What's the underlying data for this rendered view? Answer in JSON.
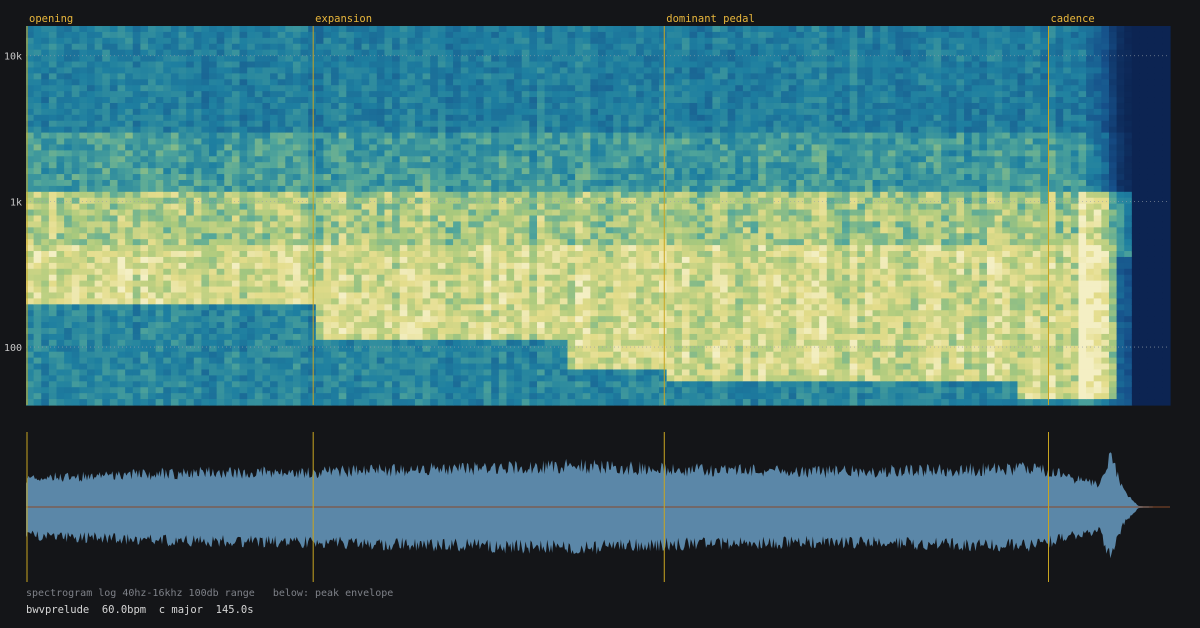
{
  "chart_data": [
    {
      "type": "heatmap",
      "title": "",
      "description_label": "spectrogram log 40hz-16khz 100db range",
      "xlabel": "",
      "ylabel": "",
      "y_scale": "log",
      "ylim": [
        40,
        16000
      ],
      "xlim": [
        0,
        145.0
      ],
      "y_ticks": [
        {
          "value": 10000,
          "label": "10k"
        },
        {
          "value": 1000,
          "label": "1k"
        },
        {
          "value": 100,
          "label": "100"
        }
      ],
      "dynamic_range_db": 100,
      "colormap": [
        "#0b1e4a",
        "#16508a",
        "#1e7fa0",
        "#52a69a",
        "#a9c97d",
        "#e3dc8a",
        "#f4efc4"
      ],
      "section_markers": [
        {
          "label": "opening",
          "time": 0.0
        },
        {
          "label": "expansion",
          "time": 36.4
        },
        {
          "label": "dominant pedal",
          "time": 80.9
        },
        {
          "label": "cadence",
          "time": 129.6
        }
      ],
      "audio_end_time": 139.8,
      "bass_regions": [
        {
          "start": 0.0,
          "end": 36.4,
          "low_band_hz": 200
        },
        {
          "start": 36.4,
          "end": 69.0,
          "low_band_hz": 110
        },
        {
          "start": 69.0,
          "end": 80.9,
          "low_band_hz": 70
        },
        {
          "start": 80.9,
          "end": 125.5,
          "low_band_hz": 60
        },
        {
          "start": 125.5,
          "end": 138.5,
          "low_band_hz": 42
        }
      ]
    },
    {
      "type": "area",
      "title": "",
      "description_label": "below: peak envelope",
      "xlim": [
        0,
        145.0
      ],
      "ylim": [
        -1,
        1
      ],
      "envelope_keypoints": [
        {
          "time": 0.0,
          "amplitude": 0.5
        },
        {
          "time": 20.0,
          "amplitude": 0.6
        },
        {
          "time": 36.4,
          "amplitude": 0.62
        },
        {
          "time": 50.0,
          "amplitude": 0.66
        },
        {
          "time": 70.0,
          "amplitude": 0.72
        },
        {
          "time": 80.9,
          "amplitude": 0.66
        },
        {
          "time": 100.0,
          "amplitude": 0.62
        },
        {
          "time": 120.0,
          "amplitude": 0.66
        },
        {
          "time": 128.0,
          "amplitude": 0.68
        },
        {
          "time": 133.0,
          "amplitude": 0.5
        },
        {
          "time": 136.0,
          "amplitude": 0.4
        },
        {
          "time": 137.5,
          "amplitude": 0.95
        },
        {
          "time": 139.0,
          "amplitude": 0.3
        },
        {
          "time": 141.0,
          "amplitude": 0.02
        },
        {
          "time": 145.0,
          "amplitude": 0.0
        }
      ],
      "fill_color": "#5b87a8",
      "midline_color": "#8a4a2a"
    }
  ],
  "captions": {
    "line1": "spectrogram log 40hz-16khz 100db range   below: peak envelope",
    "line2": "bwvprelude  60.0bpm  c major  145.0s"
  },
  "colors": {
    "background": "#141518",
    "marker": "#c9a520",
    "marker_label": "#e8b63c",
    "tick_label": "#c8c8c8",
    "grid": "#9aa0a8"
  }
}
